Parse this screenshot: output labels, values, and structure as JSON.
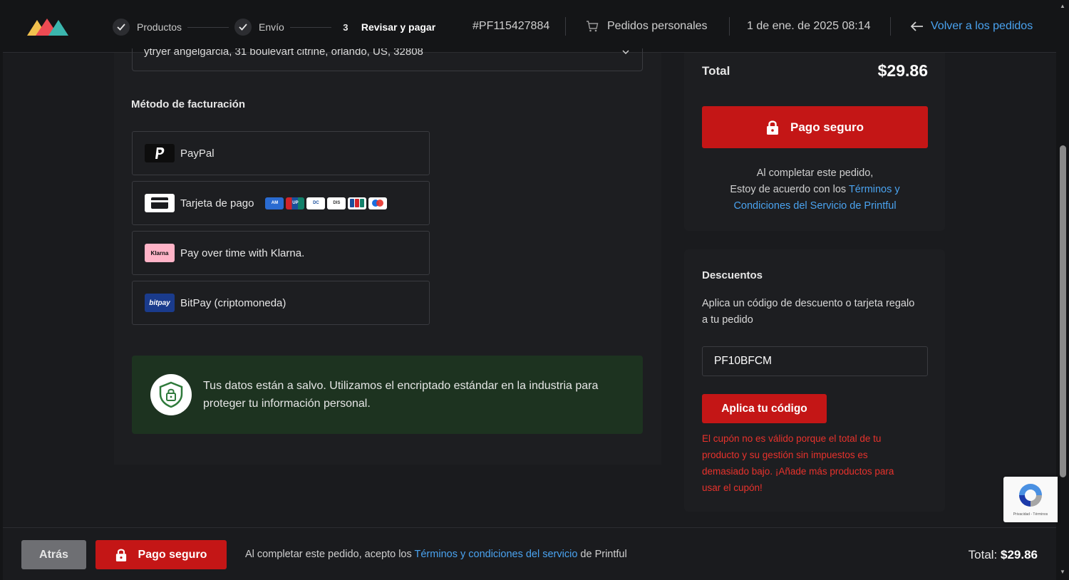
{
  "header": {
    "steps": [
      {
        "label": "Productos",
        "state": "done"
      },
      {
        "label": "Envío",
        "state": "done"
      },
      {
        "number": "3",
        "label": "Revisar y pagar",
        "state": "active"
      }
    ],
    "order_id": "#PF115427884",
    "store_label": "Pedidos personales",
    "date": "1 de ene. de 2025 08:14",
    "back_link": "Volver a los pedidos"
  },
  "shipping": {
    "address_partial": "ytryer angelgarcia, 31 boulevart citrine, orlando, US, 32808"
  },
  "billing": {
    "title": "Método de facturación",
    "options": [
      {
        "label": "PayPal",
        "icon": "paypal-icon"
      },
      {
        "label": "Tarjeta de pago",
        "icon": "credit-card-icon",
        "card_brands": [
          "AMEX",
          "UnionPay",
          "Diners Club",
          "Discover",
          "JCB",
          "Maestro"
        ]
      },
      {
        "label": "Pay over time with Klarna.",
        "icon": "klarna-icon",
        "icon_text": "Klarna"
      },
      {
        "label": "BitPay (criptomoneda)",
        "icon": "bitpay-icon",
        "icon_text": "bitpay"
      }
    ],
    "secure_message": "Tus datos están a salvo. Utilizamos el encriptado estándar en la industria para proteger tu información personal."
  },
  "summary": {
    "total_label": "Total",
    "total_value": "$29.86",
    "pay_button": "Pago seguro",
    "agree_line1": "Al completar este pedido,",
    "agree_line2": "Estoy de acuerdo con los ",
    "terms_link": "Términos y Condiciones del Servicio de Printful"
  },
  "discounts": {
    "title": "Descuentos",
    "description": "Aplica un código de descuento o tarjeta regalo a tu pedido",
    "code_value": "PF10BFCM",
    "apply_button": "Aplica tu código",
    "error": "El cupón no es válido porque el total de tu producto y su gestión sin impuestos es demasiado bajo. ¡Añade más productos para usar el cupón!"
  },
  "footer": {
    "back_button": "Atrás",
    "pay_button": "Pago seguro",
    "text_before": "Al completar este pedido, acepto los ",
    "terms_link": "Términos y condiciones del servicio",
    "text_after": " de Printful",
    "total_label": "Total: ",
    "total_value": "$29.86"
  },
  "recaptcha": {
    "text": "Privacidad - Términos"
  },
  "colors": {
    "accent_red": "#c41616",
    "link_blue": "#4aa3f0",
    "error_red": "#e8322c",
    "secure_green": "#1d3320"
  }
}
